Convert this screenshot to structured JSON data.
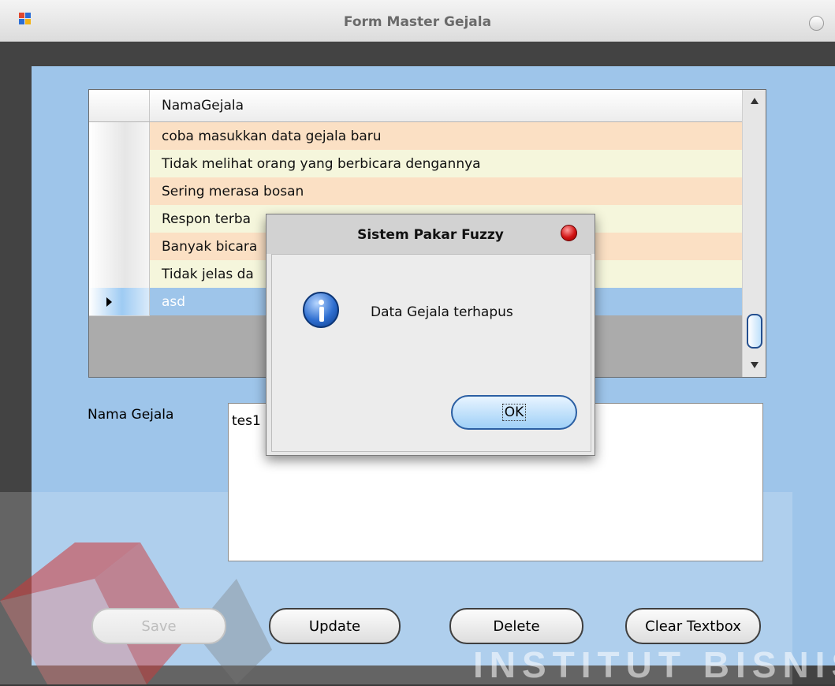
{
  "window": {
    "title": "Form Master Gejala"
  },
  "grid": {
    "column_header": "NamaGejala",
    "rows": [
      "coba masukkan data gejala baru",
      "Tidak melihat orang yang berbicara dengannya",
      "Sering merasa bosan",
      "Respon terba",
      "Banyak bicara",
      "Tidak jelas da",
      "asd"
    ],
    "selected_row_index": 6,
    "row_colors": [
      "#fbe0c4",
      "#f5f6dc"
    ],
    "selected_color": "#9ec5ea"
  },
  "form": {
    "nama_gejala_label": "Nama Gejala",
    "nama_gejala_value": "tes1"
  },
  "buttons": {
    "save": "Save",
    "update": "Update",
    "delete": "Delete",
    "clear": "Clear Textbox"
  },
  "dialog": {
    "title": "Sistem Pakar Fuzzy",
    "message": "Data Gejala terhapus",
    "ok": "OK"
  },
  "watermark": {
    "text": "INSTITUT BISNIS"
  },
  "colors": {
    "client_bg": "#9ec5ea",
    "window_frame": "#434343"
  }
}
